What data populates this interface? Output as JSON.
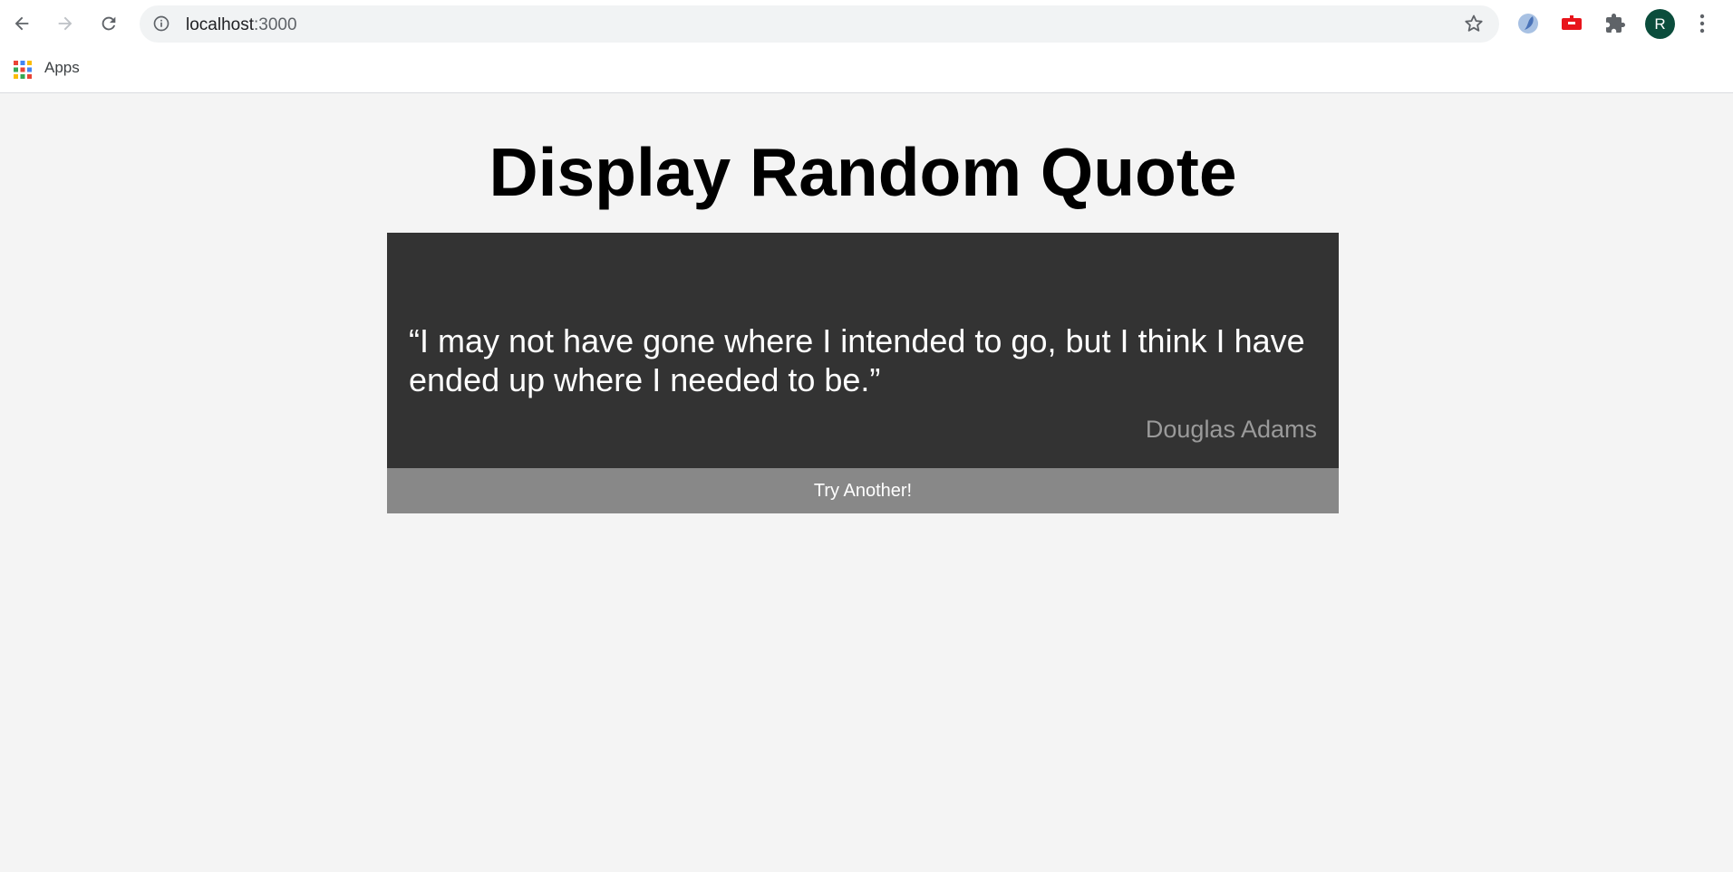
{
  "browser": {
    "url_host": "localhost",
    "url_port": ":3000",
    "profile_initial": "R",
    "bookmarks": [
      {
        "label": "Apps",
        "icon": "apps-grid-icon"
      }
    ],
    "icons": {
      "back": "back-arrow-icon",
      "forward": "forward-arrow-icon",
      "reload": "reload-icon",
      "site_info": "info-icon",
      "bookmark": "star-icon",
      "extension_1": "extension-globe-icon",
      "extension_2": "extension-red-icon",
      "extensions": "puzzle-icon",
      "menu": "kebab-menu-icon"
    },
    "colors": {
      "avatar": "#0b4d3c"
    }
  },
  "page": {
    "title": "Display Random Quote",
    "quote": {
      "text": "“I may not have gone where I intended to go, but I think I have ended up where I needed to be.”",
      "author": "Douglas Adams"
    },
    "button_label": "Try Another!",
    "colors": {
      "background": "#f4f4f4",
      "card": "#333333",
      "button": "#888888",
      "author_text": "#9a9a9a"
    }
  }
}
